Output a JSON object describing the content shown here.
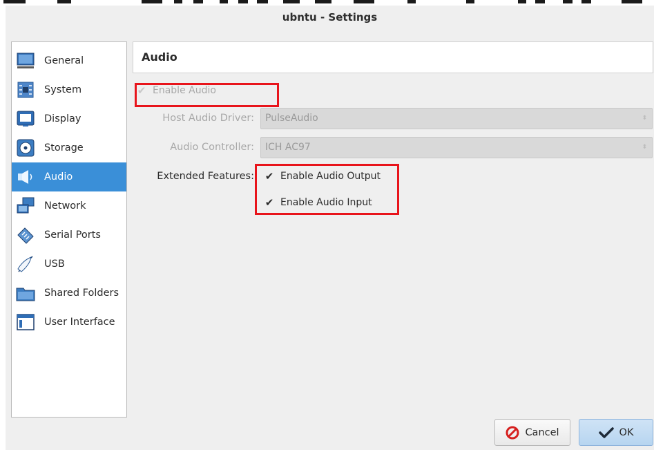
{
  "window": {
    "title": "ubntu - Settings"
  },
  "sidebar": {
    "items": [
      {
        "label": "General",
        "icon": "monitor-icon",
        "active": false
      },
      {
        "label": "System",
        "icon": "chip-icon",
        "active": false
      },
      {
        "label": "Display",
        "icon": "display-icon",
        "active": false
      },
      {
        "label": "Storage",
        "icon": "storage-icon",
        "active": false
      },
      {
        "label": "Audio",
        "icon": "speaker-icon",
        "active": true
      },
      {
        "label": "Network",
        "icon": "network-icon",
        "active": false
      },
      {
        "label": "Serial Ports",
        "icon": "serial-port-icon",
        "active": false
      },
      {
        "label": "USB",
        "icon": "usb-icon",
        "active": false
      },
      {
        "label": "Shared Folders",
        "icon": "folder-icon",
        "active": false
      },
      {
        "label": "User Interface",
        "icon": "window-icon",
        "active": false
      }
    ]
  },
  "page": {
    "title": "Audio",
    "enable_audio": {
      "label": "Enable Audio",
      "checked": true,
      "enabled": false
    },
    "host_driver": {
      "label": "Host Audio Driver:",
      "value": "PulseAudio"
    },
    "controller": {
      "label": "Audio Controller:",
      "value": "ICH AC97"
    },
    "extended": {
      "label": "Extended Features:",
      "output": {
        "label": "Enable Audio Output",
        "checked": true
      },
      "input": {
        "label": "Enable Audio Input",
        "checked": true
      }
    }
  },
  "buttons": {
    "cancel": "Cancel",
    "ok": "OK"
  },
  "colors": {
    "selection": "#3a8fd8",
    "annotation": "#e8141b",
    "ok_button": "#b7d5f0"
  }
}
